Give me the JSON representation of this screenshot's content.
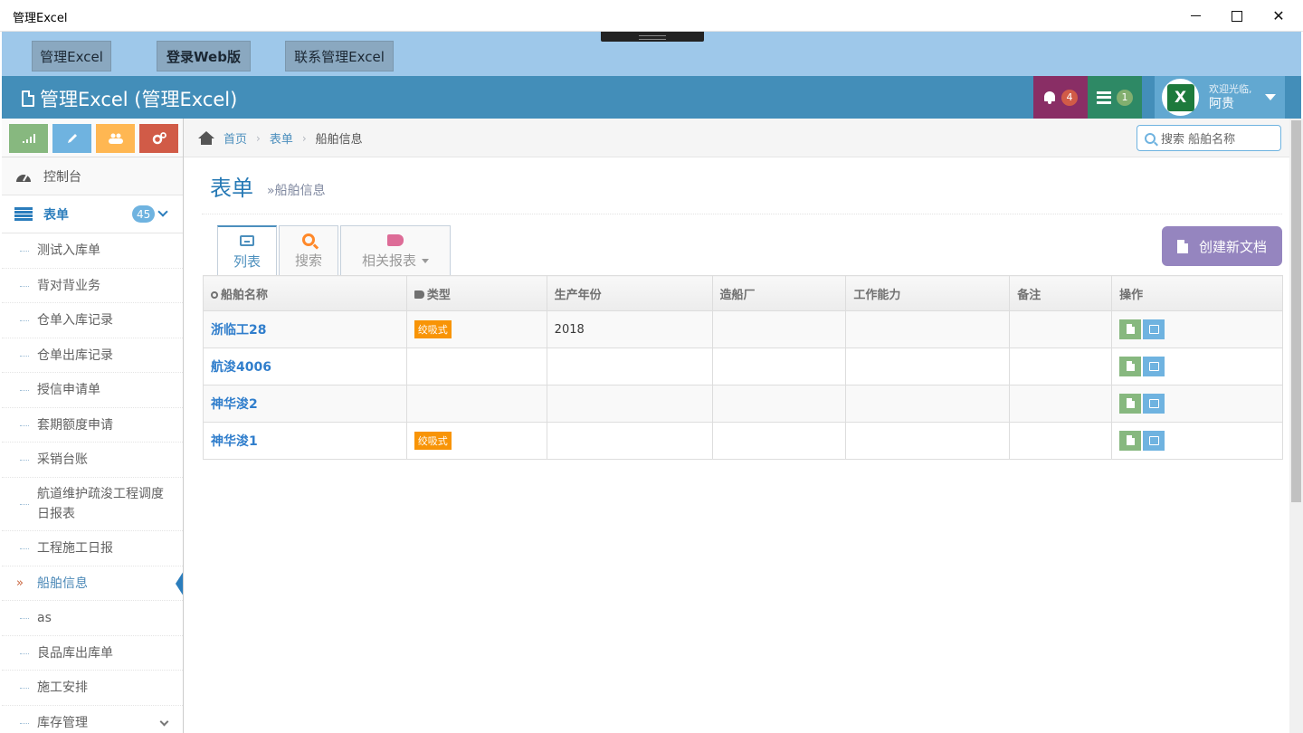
{
  "window": {
    "title": "管理Excel"
  },
  "toolbar": {
    "buttons": [
      "管理Excel",
      "登录Web版",
      "联系管理Excel"
    ]
  },
  "navbar": {
    "brand": "管理Excel (管理Excel)",
    "notifications_count": "4",
    "messages_count": "1",
    "user_greeting": "欢迎光临,",
    "user_name": "阿贵"
  },
  "sidebar": {
    "dashboard": "控制台",
    "forms": {
      "label": "表单",
      "count": "45"
    },
    "items": [
      "测试入库单",
      "背对背业务",
      "仓单入库记录",
      "仓单出库记录",
      "授信申请单",
      "套期额度申请",
      "采销台账",
      "航道维护疏浚工程调度日报表",
      "工程施工日报",
      "船舶信息",
      "as",
      "良品库出库单",
      "施工安排",
      "库存管理"
    ],
    "active_item": "船舶信息",
    "active_marker": "»"
  },
  "breadcrumbs": {
    "home": "首页",
    "section": "表单",
    "current": "船舶信息"
  },
  "search": {
    "placeholder": "搜索 船舶名称"
  },
  "page_header": {
    "title": "表单",
    "subtitle": "»船舶信息"
  },
  "tabs": {
    "list": "列表",
    "search": "搜索",
    "reports": "相关报表"
  },
  "create_button": "创建新文档",
  "table": {
    "columns": [
      "船舶名称",
      "类型",
      "生产年份",
      "造船厂",
      "工作能力",
      "备注",
      "操作"
    ],
    "rows": [
      {
        "name": "浙临工28",
        "type": "绞吸式",
        "year": "2018",
        "yard": "",
        "capacity": "",
        "note": ""
      },
      {
        "name": "航浚4006",
        "type": "",
        "year": "",
        "yard": "",
        "capacity": "",
        "note": ""
      },
      {
        "name": "神华浚2",
        "type": "",
        "year": "",
        "yard": "",
        "capacity": "",
        "note": ""
      },
      {
        "name": "神华浚1",
        "type": "绞吸式",
        "year": "",
        "yard": "",
        "capacity": "",
        "note": ""
      }
    ]
  },
  "colors": {
    "navbar": "#438eb9",
    "toolbar": "#9ec8ea",
    "notif": "#892e65",
    "messages": "#2e8965",
    "accent": "#2679b5",
    "create": "#9585bf",
    "tag": "#f89406"
  }
}
